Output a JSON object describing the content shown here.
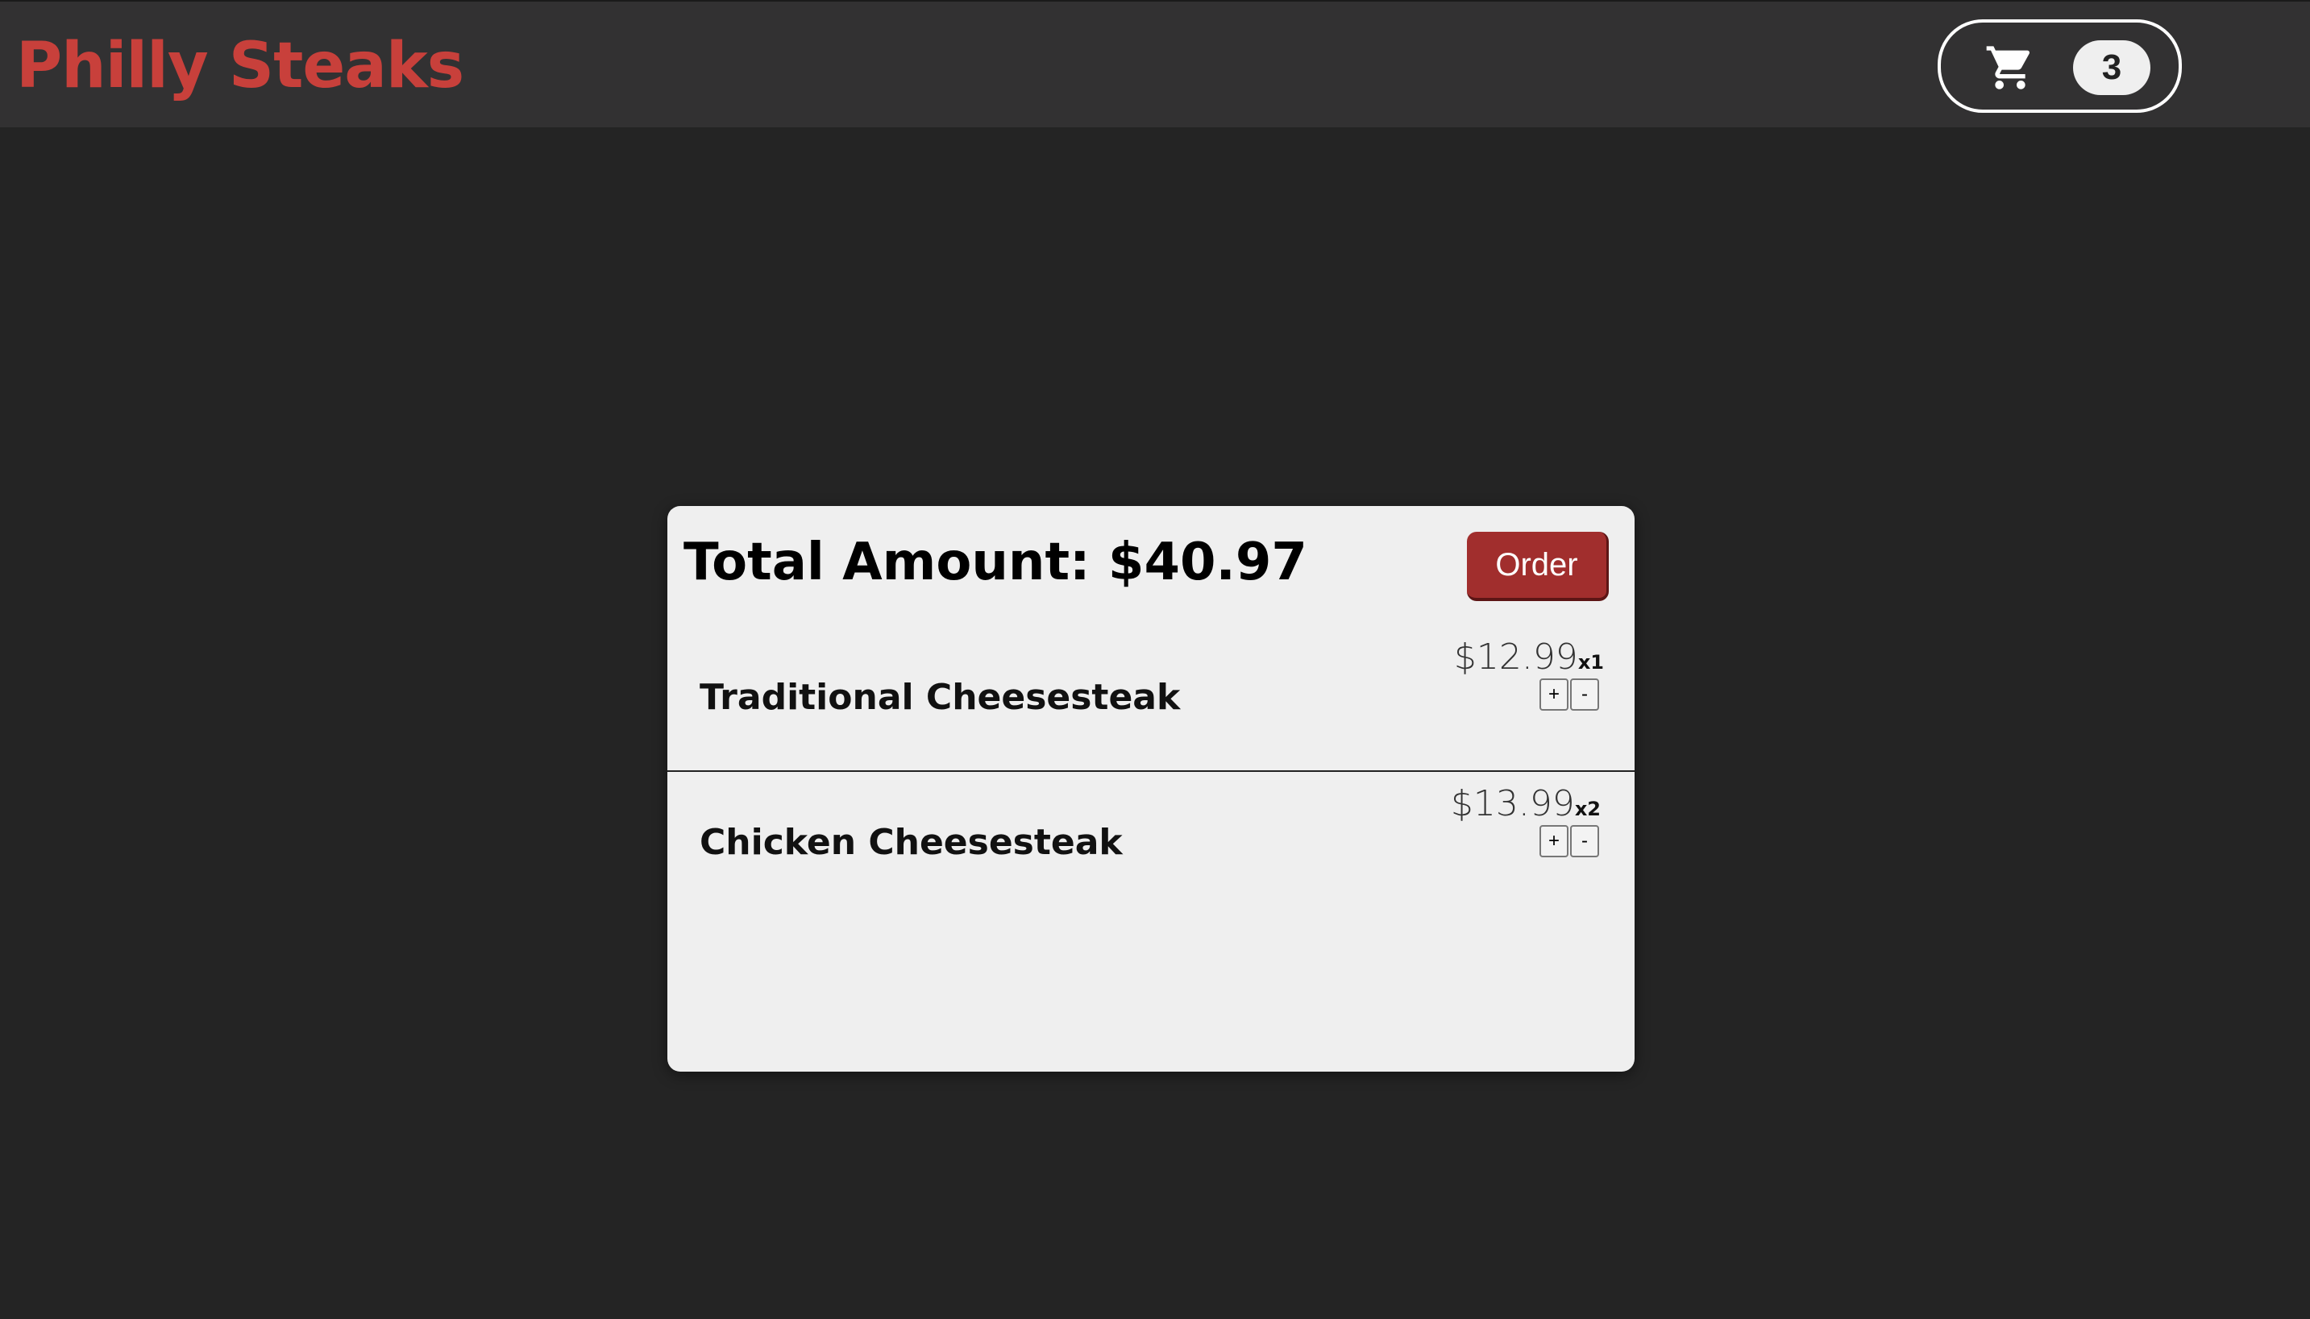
{
  "header": {
    "brand": "Philly Steaks",
    "cart_count": "3",
    "cart_icon": "shopping-cart-icon"
  },
  "cart": {
    "total_label": "Total Amount: $40.97",
    "order_label": "Order",
    "items": [
      {
        "name": "Traditional Cheesesteak",
        "price": "$12.99",
        "quantity": "x1",
        "increment_label": "+",
        "decrement_label": "-"
      },
      {
        "name": "Chicken Cheesesteak",
        "price": "$13.99",
        "quantity": "x2",
        "increment_label": "+",
        "decrement_label": "-"
      }
    ]
  },
  "colors": {
    "page_background": "#242424",
    "header_background": "#323132",
    "brand": "#c8403b",
    "order_button": "#a12e2d",
    "modal_background": "#efefef"
  }
}
